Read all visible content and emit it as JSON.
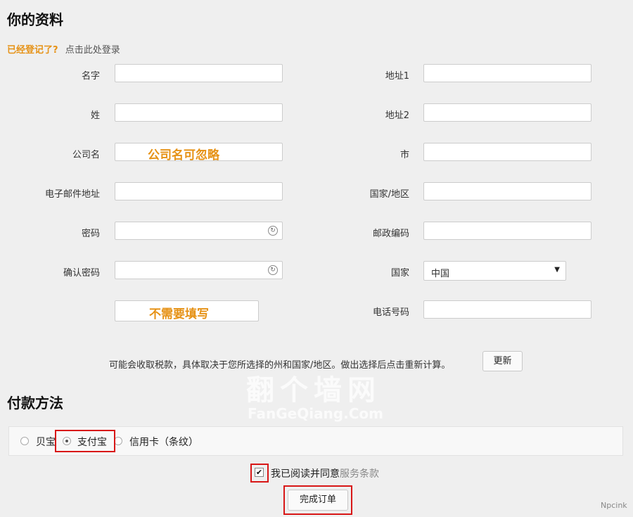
{
  "section_profile": {
    "title": "你的资料",
    "already_registered": "已经登记了?",
    "login_link": "点击此处登录"
  },
  "left_fields": [
    {
      "label": "名字"
    },
    {
      "label": "姓"
    },
    {
      "label": "公司名",
      "overlay_hint": "公司名可忽略"
    },
    {
      "label": "电子邮件地址"
    },
    {
      "label": "密码"
    },
    {
      "label": "确认密码"
    },
    {
      "label": "",
      "overlay_hint": "不需要填写"
    }
  ],
  "right_fields": [
    {
      "label": "地址1"
    },
    {
      "label": "地址2"
    },
    {
      "label": "市"
    },
    {
      "label": "国家/地区"
    },
    {
      "label": "邮政编码"
    },
    {
      "label": "国家",
      "selected": "中国"
    },
    {
      "label": "电话号码"
    }
  ],
  "tax_note": "可能会收取税款，具体取决于您所选择的州和国家/地区。做出选择后点击重新计算。",
  "update_button": "更新",
  "payment": {
    "title": "付款方法",
    "options": [
      "贝宝",
      "支付宝",
      "信用卡（条纹）"
    ],
    "selected_index": 1
  },
  "terms": {
    "text": "我已阅读并同意",
    "link": "服务条款",
    "checked": true
  },
  "complete_button": "完成订单",
  "watermark": {
    "main": "翻个墙网",
    "sub": "FanGeQiang.Com"
  },
  "corner_mark": "Npcink",
  "colors": {
    "hint_orange": "#e69216",
    "highlight_red": "#d81717"
  }
}
